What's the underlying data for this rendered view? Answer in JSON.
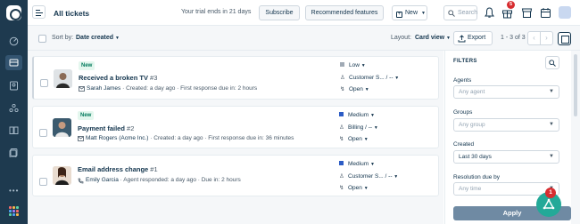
{
  "header": {
    "title": "All tickets",
    "trial_text": "Your trial ends in 21 days",
    "subscribe_label": "Subscribe",
    "recommended_label": "Recommended features",
    "new_label": "New",
    "search_placeholder": "Search",
    "gift_badge": "5"
  },
  "toolbar": {
    "sort_label": "Sort by:",
    "sort_value": "Date created",
    "layout_label": "Layout:",
    "layout_value": "Card view",
    "export_label": "Export",
    "pager_text": "1 - 3 of 3"
  },
  "tickets": [
    {
      "tag": "New",
      "subject": "Received a broken TV",
      "number": "#3",
      "requester": "Sarah James",
      "meta": "Created: a day ago · First response due in: 2 hours",
      "priority": "Low",
      "priority_color": "#a0aab5",
      "group": "Customer S... / --",
      "status": "Open"
    },
    {
      "tag": "New",
      "subject": "Payment failed",
      "number": "#2",
      "requester": "Matt Rogers (Acme Inc.)",
      "meta": "Created: a day ago · First response due in: 36 minutes",
      "priority": "Medium",
      "priority_color": "#2c5cc5",
      "group": "Billing / --",
      "status": "Open"
    },
    {
      "tag": "",
      "subject": "Email address change",
      "number": "#1",
      "requester": "Emily Garcia",
      "meta": "Agent responded: a day ago · Due in: 2 hours",
      "priority": "Medium",
      "priority_color": "#2c5cc5",
      "group": "Customer S... / --",
      "status": "Open"
    }
  ],
  "filters": {
    "heading": "FILTERS",
    "agents_label": "Agents",
    "agents_placeholder": "Any agent",
    "groups_label": "Groups",
    "groups_placeholder": "Any group",
    "created_label": "Created",
    "created_value": "Last 30 days",
    "resolution_label": "Resolution due by",
    "resolution_placeholder": "Any time",
    "apply_label": "Apply"
  },
  "fab_badge": "1",
  "colors": {
    "nav_bg": "#1e3a4f",
    "accent": "#23a998",
    "badge": "#d72d30"
  }
}
